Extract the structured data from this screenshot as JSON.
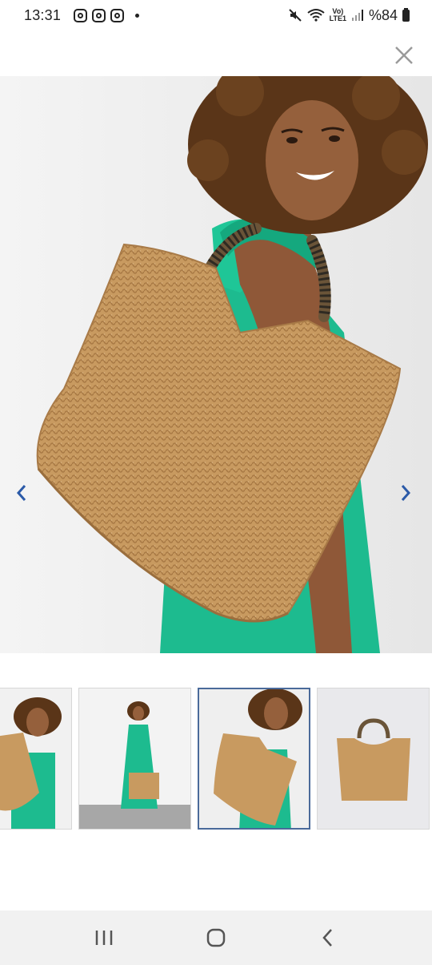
{
  "status_bar": {
    "time": "13:31",
    "network_label_top": "Vo)",
    "network_label_bottom": "LTE1",
    "battery_text": "%84"
  },
  "gallery": {
    "total_images": 4,
    "selected_index": 3
  },
  "colors": {
    "arrow": "#2b5aa8",
    "bag": "#c89a60",
    "dress": "#1dbb8f",
    "skin": "#8a5535",
    "hair": "#5a3518",
    "photo_bg": "#ececec",
    "thumb_selected_border": "#4a6a9a"
  },
  "icons": {
    "close": "close-icon",
    "prev": "chevron-left-icon",
    "next": "chevron-right-icon",
    "recents": "recents-icon",
    "home": "home-icon",
    "back": "back-icon"
  }
}
